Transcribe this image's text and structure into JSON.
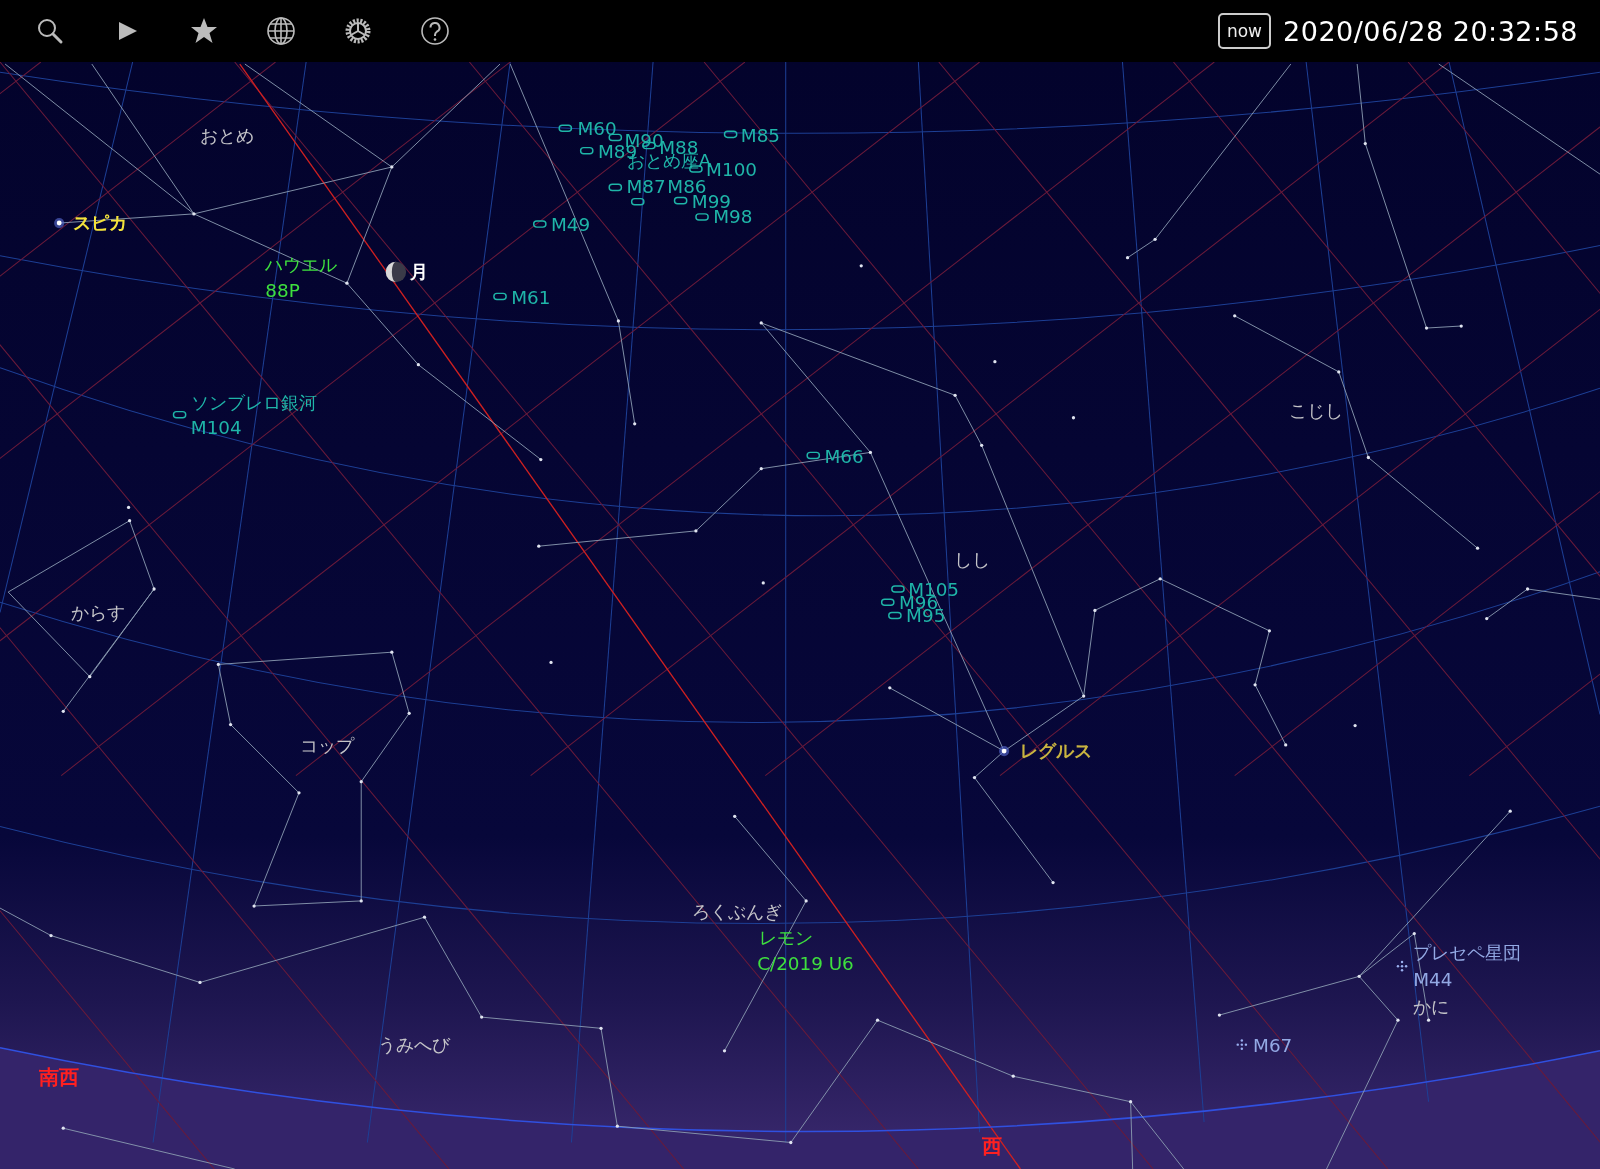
{
  "toolbar": [
    {
      "kind": "search"
    },
    {
      "kind": "play"
    },
    {
      "kind": "star"
    },
    {
      "kind": "globe"
    },
    {
      "kind": "settings"
    },
    {
      "kind": "help"
    }
  ],
  "now_button": {
    "label": "now"
  },
  "datetime": "2020/06/28 20:32:58",
  "constellations": [
    "おとめ",
    "からす",
    "コップ",
    "ろくぶんぎ",
    "しし",
    "こじし",
    "うみへび",
    "かに"
  ],
  "objects": [
    {
      "kind": "star",
      "labels": [
        "スピカ"
      ]
    },
    {
      "kind": "star",
      "labels": [
        "レグルス"
      ]
    },
    {
      "kind": "moon",
      "labels": [
        "月"
      ]
    },
    {
      "kind": "comet",
      "labels": [
        "ハウエル",
        "88P"
      ]
    },
    {
      "kind": "comet",
      "labels": [
        "レモン",
        "C/2019 U6"
      ]
    },
    {
      "kind": "galaxy",
      "labels": [
        "M60"
      ]
    },
    {
      "kind": "galaxy",
      "labels": [
        "M89"
      ]
    },
    {
      "kind": "galaxy",
      "labels": [
        "M90"
      ]
    },
    {
      "kind": "galaxy",
      "labels": [
        "M88"
      ]
    },
    {
      "kind": "radio",
      "labels": [
        "おとめ座A"
      ]
    },
    {
      "kind": "galaxy",
      "labels": [
        "M100"
      ]
    },
    {
      "kind": "galaxy",
      "labels": [
        "M87"
      ]
    },
    {
      "kind": "galaxy",
      "labels": [
        "M86"
      ]
    },
    {
      "kind": "galaxy",
      "labels": [
        "M99"
      ]
    },
    {
      "kind": "galaxy",
      "labels": [
        "M98"
      ]
    },
    {
      "kind": "galaxy",
      "labels": [
        "M85"
      ]
    },
    {
      "kind": "galaxy",
      "labels": [
        "M49"
      ]
    },
    {
      "kind": "galaxy",
      "labels": [
        "M61"
      ]
    },
    {
      "kind": "galaxy",
      "labels": [
        "ソンブレロ銀河",
        "M104"
      ]
    },
    {
      "kind": "galaxy",
      "labels": [
        "M66"
      ]
    },
    {
      "kind": "galaxy",
      "labels": [
        "M105"
      ]
    },
    {
      "kind": "galaxy",
      "labels": [
        "M96"
      ]
    },
    {
      "kind": "galaxy",
      "labels": [
        "M95"
      ]
    },
    {
      "kind": "cluster",
      "labels": [
        "プレセペ星団",
        "M44"
      ]
    },
    {
      "kind": "cluster",
      "labels": [
        "M67"
      ]
    }
  ],
  "directions": [
    "南西",
    "西"
  ]
}
